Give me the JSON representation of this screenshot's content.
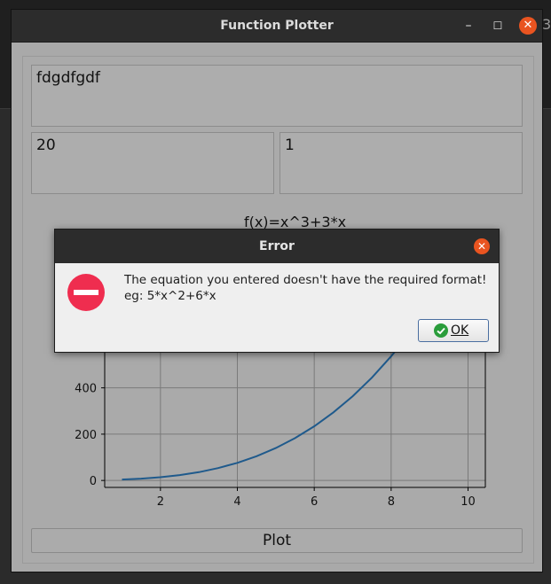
{
  "window": {
    "title": "Function Plotter",
    "minimize_glyph": "–",
    "maximize_glyph": "☐",
    "close_glyph": "✕"
  },
  "inputs": {
    "equation_value": "fdgdfgdf",
    "max_x_value": "20",
    "min_x_value": "1"
  },
  "plot_button_label": "Plot",
  "chart_data": {
    "type": "line",
    "title": "f(x)=x^3+3*x",
    "xlabel": "",
    "ylabel": "",
    "xlim": [
      0.55,
      10.45
    ],
    "ylim": [
      -30,
      1080
    ],
    "xticks": [
      2,
      4,
      6,
      8,
      10
    ],
    "yticks": [
      0,
      200,
      400
    ],
    "grid": true,
    "series": [
      {
        "color": "#1f5a8c",
        "x": [
          1,
          1.5,
          2,
          2.5,
          3,
          3.5,
          4,
          4.5,
          5,
          5.5,
          6,
          6.5,
          7,
          7.5,
          8,
          8.5,
          9,
          9.5,
          10
        ],
        "y": [
          4,
          7.875,
          14,
          23.125,
          36,
          53.375,
          76,
          104.625,
          140,
          182.875,
          234,
          294.125,
          364,
          444.375,
          536,
          639.625,
          756,
          885.875,
          1030
        ]
      }
    ]
  },
  "dialog": {
    "title": "Error",
    "close_glyph": "✕",
    "message_line1": "The equation you entered doesn't have the required format!",
    "message_line2": "eg: 5*x^2+6*x",
    "ok_label": "OK",
    "icon": "error-stop-icon",
    "accent_color": "#e95420",
    "error_color": "#ef2d4f"
  }
}
